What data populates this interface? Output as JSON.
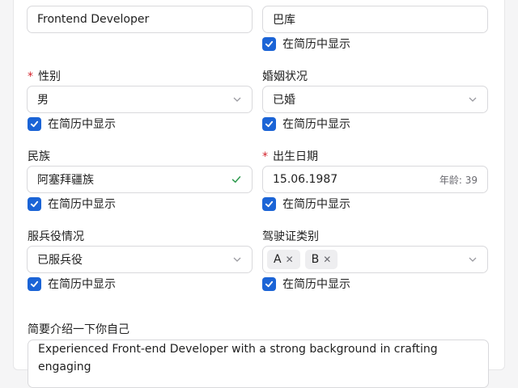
{
  "form": {
    "row0": {
      "left_value": "Frontend Developer",
      "right_value": "巴库",
      "right_show_label": "在简历中显示"
    },
    "gender": {
      "label": "性别",
      "value": "男",
      "show_label": "在简历中显示"
    },
    "marital": {
      "label": "婚姻状况",
      "value": "已婚",
      "show_label": "在简历中显示"
    },
    "ethnicity": {
      "label": "民族",
      "value": "阿塞拜疆族",
      "show_label": "在简历中显示"
    },
    "birth": {
      "label": "出生日期",
      "value": "15.06.1987",
      "age_text": "年龄: 39",
      "show_label": "在简历中显示"
    },
    "military": {
      "label": "服兵役情况",
      "value": "已服兵役",
      "show_label": "在简历中显示"
    },
    "license": {
      "label": "驾驶证类别",
      "tags": [
        "A",
        "B"
      ],
      "show_label": "在简历中显示"
    },
    "about": {
      "label": "简要介绍一下你自己",
      "value": "Experienced Front-end Developer with a strong background in crafting engaging"
    }
  },
  "colors": {
    "accent": "#1b64d6",
    "required": "#d4232b",
    "success": "#2e9a4e"
  }
}
